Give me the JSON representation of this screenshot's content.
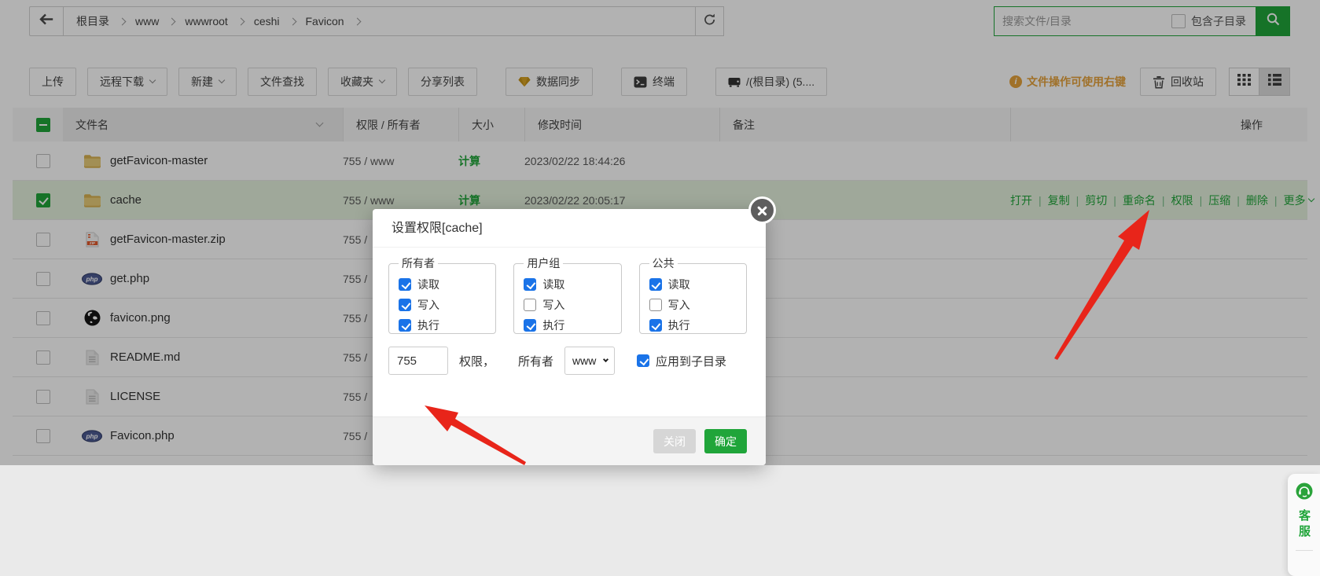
{
  "topbar": {
    "breadcrumb": {
      "items": [
        "根目录",
        "www",
        "wwwroot",
        "ceshi",
        "Favicon"
      ]
    },
    "search": {
      "placeholder": "搜索文件/目录",
      "include_sub_label": "包含子目录",
      "include_sub_checked": false
    }
  },
  "toolbar": {
    "left_buttons": [
      {
        "label": "上传"
      },
      {
        "label": "远程下载",
        "dropdown": true
      },
      {
        "label": "新建",
        "dropdown": true
      },
      {
        "label": "文件查找"
      },
      {
        "label": "收藏夹",
        "dropdown": true
      },
      {
        "label": "分享列表"
      },
      {
        "label": "数据同步",
        "icon": "gem",
        "gap": true
      },
      {
        "label": "终端",
        "icon": "terminal",
        "gap": true
      },
      {
        "label": "/(根目录) (5....",
        "icon": "disk",
        "gap": true
      }
    ],
    "hint_text": "文件操作可使用右键",
    "recycle_label": "回收站"
  },
  "table": {
    "headers": {
      "name": "文件名",
      "perm": "权限 / 所有者",
      "size": "大小",
      "mtime": "修改时间",
      "note": "备注",
      "action": "操作"
    },
    "rows": [
      {
        "name": "getFavicon-master",
        "icon": "folder",
        "perm": "755 / www",
        "size": "计算",
        "mtime": "2023/02/22 18:44:26",
        "checked": false,
        "selected": false
      },
      {
        "name": "cache",
        "icon": "folder",
        "perm": "755 / www",
        "size": "计算",
        "mtime": "2023/02/22 20:05:17",
        "checked": true,
        "selected": true,
        "actions": [
          "打开",
          "复制",
          "剪切",
          "重命名",
          "权限",
          "压缩",
          "删除"
        ],
        "more_label": "更多"
      },
      {
        "name": "getFavicon-master.zip",
        "icon": "zip",
        "perm": "755 /",
        "size": "",
        "mtime": "",
        "checked": false,
        "selected": false
      },
      {
        "name": "get.php",
        "icon": "php",
        "perm": "755 /",
        "size": "",
        "mtime": "",
        "checked": false,
        "selected": false
      },
      {
        "name": "favicon.png",
        "icon": "globe",
        "perm": "755 /",
        "size": "",
        "mtime": "",
        "checked": false,
        "selected": false
      },
      {
        "name": "README.md",
        "icon": "file",
        "perm": "755 /",
        "size": "",
        "mtime": "",
        "checked": false,
        "selected": false
      },
      {
        "name": "LICENSE",
        "icon": "file",
        "perm": "755 /",
        "size": "",
        "mtime": "",
        "checked": false,
        "selected": false
      },
      {
        "name": "Favicon.php",
        "icon": "php",
        "perm": "755 /",
        "size": "",
        "mtime": "",
        "checked": false,
        "selected": false
      }
    ]
  },
  "modal": {
    "title": "设置权限[cache]",
    "groups": [
      {
        "legend": "所有者",
        "items": [
          {
            "label": "读取",
            "checked": true
          },
          {
            "label": "写入",
            "checked": true
          },
          {
            "label": "执行",
            "checked": true
          }
        ]
      },
      {
        "legend": "用户组",
        "items": [
          {
            "label": "读取",
            "checked": true
          },
          {
            "label": "写入",
            "checked": false
          },
          {
            "label": "执行",
            "checked": true
          }
        ]
      },
      {
        "legend": "公共",
        "items": [
          {
            "label": "读取",
            "checked": true
          },
          {
            "label": "写入",
            "checked": false
          },
          {
            "label": "执行",
            "checked": true
          }
        ]
      }
    ],
    "perm_value": "755",
    "perm_label": "权限，",
    "owner_label": "所有者",
    "owner_value": "www",
    "apply_sub_label": "应用到子目录",
    "apply_sub_checked": true,
    "close_label": "关闭",
    "ok_label": "确定"
  },
  "kefu": {
    "label": "客服"
  },
  "colors": {
    "primary_green": "#20a53a",
    "hint_orange": "#e6a23c",
    "check_blue": "#1a73e8",
    "arrow_red": "#e8251a",
    "selected_row": "#e4f1dd"
  }
}
